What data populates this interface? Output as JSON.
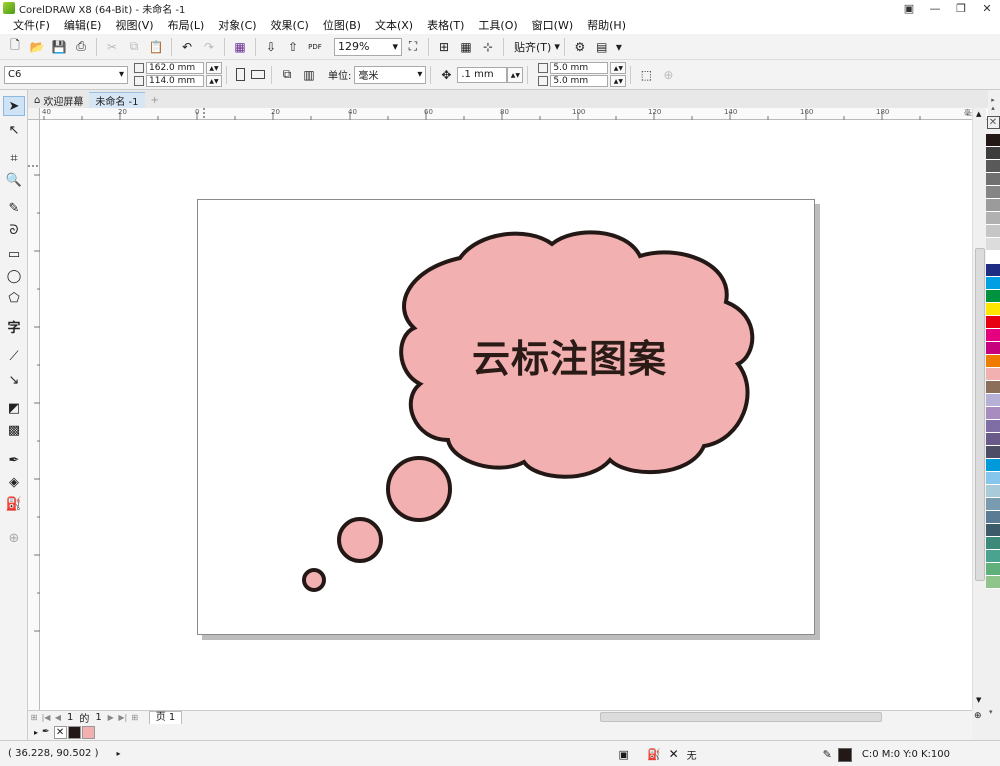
{
  "window": {
    "title": "CorelDRAW X8 (64-Bit) - 未命名 -1"
  },
  "menu": [
    "文件(F)",
    "编辑(E)",
    "视图(V)",
    "布局(L)",
    "对象(C)",
    "效果(C)",
    "位图(B)",
    "文本(X)",
    "表格(T)",
    "工具(O)",
    "窗口(W)",
    "帮助(H)"
  ],
  "toolbar": {
    "zoom": "129%",
    "snap_label": "贴齐(T)",
    "pdf": "PDF"
  },
  "property_bar": {
    "paper_size": "C6",
    "width": "162.0 mm",
    "height": "114.0 mm",
    "unit_label": "单位:",
    "unit": "毫米",
    "nudge": ".1 mm",
    "dup_x": "5.0 mm",
    "dup_y": "5.0 mm"
  },
  "tabs": {
    "welcome": "欢迎屏幕",
    "document": "未命名 -1"
  },
  "ruler": {
    "h_ticks": [
      "40",
      "20",
      "0",
      "20",
      "40",
      "60",
      "80",
      "100",
      "120",
      "140",
      "160",
      "180"
    ],
    "unit": "毫米"
  },
  "canvas": {
    "cloud_text": "云标注图案"
  },
  "page_nav": {
    "current": "1",
    "of": "的",
    "total": "1",
    "page_tab": "页 1"
  },
  "status": {
    "coords": "( 36.228, 90.502 )",
    "outline": "无",
    "color_model": "C:0 M:0 Y:0 K:100"
  },
  "colors": {
    "cloud_fill": "#f2b0b0",
    "cloud_stroke": "#231815",
    "palette": [
      "#231815",
      "#3d3d3d",
      "#595959",
      "#707070",
      "#858585",
      "#9b9b9b",
      "#b1b1b1",
      "#c6c6c6",
      "#dcdcdc",
      "#ffffff",
      "#1f2c84",
      "#009fe3",
      "#00923f",
      "#ffe600",
      "#e60012",
      "#e4007f",
      "#c7007d",
      "#ef7b00",
      "#f2b0b0",
      "#8b6f5a",
      "#b7b0d6",
      "#a88cbf",
      "#7f6ea6",
      "#6a5a8a",
      "#4d4d66",
      "#0099d9",
      "#86c6ec",
      "#a9cbd9",
      "#7a9ab0",
      "#5b7a94",
      "#3d5a6b",
      "#3e8a7a",
      "#4aa38f",
      "#5fb07a",
      "#8fc48a"
    ],
    "doc_palette": [
      "#231815",
      "#f2b0b0"
    ]
  }
}
